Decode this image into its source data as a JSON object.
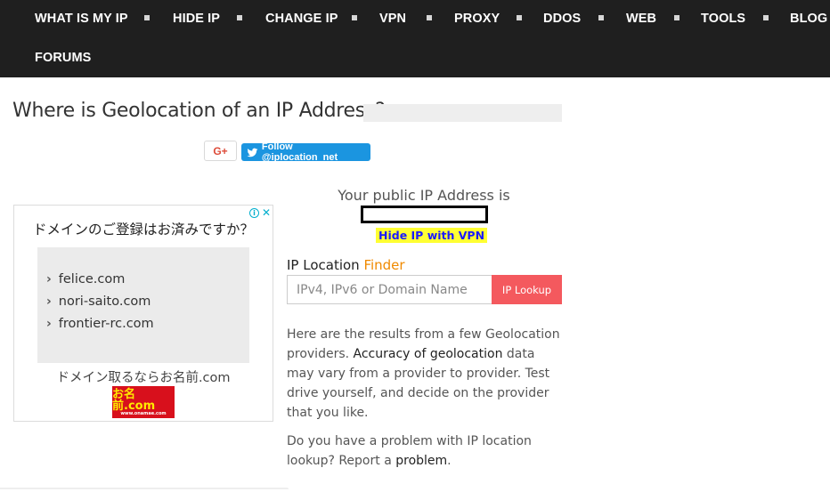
{
  "nav": {
    "row1": [
      "WHAT IS MY IP",
      "HIDE IP",
      "CHANGE IP",
      "VPN",
      "PROXY",
      "DDOS",
      "WEB",
      "TOOLS",
      "BLOG"
    ],
    "row2": [
      "FORUMS"
    ]
  },
  "title": "Where is Geolocation of an IP Address?",
  "social": {
    "gplus_label": "G+",
    "twitter_label": "Follow @iplocation_net"
  },
  "ad": {
    "headline": "ドメインのご登録はお済みですか？",
    "domains": [
      "felice.com",
      "nori-saito.com",
      "frontier-rc.com"
    ],
    "caption": "ドメイン取るならお名前.com",
    "logo_text": "お名前.com",
    "logo_subtext": "www.onamae.com"
  },
  "public_ip": {
    "label": "Your public IP Address is",
    "vpn_link": "Hide IP with VPN"
  },
  "finder": {
    "title_main": "IP Location ",
    "title_accent": "Finder",
    "input_placeholder": "IPv4, IPv6 or Domain Name",
    "button_label": "IP Lookup"
  },
  "intro": {
    "p1_part1": "Here are the results from a few Geolocation providers. ",
    "p1_link": "Accuracy of geolocation",
    "p1_part2": " data may vary from a provider to provider. Test drive yourself, and decide on the provider that you like.",
    "p2_part1": "Do you have a problem with IP location lookup? Report a ",
    "p2_link": "problem",
    "p2_part2": "."
  },
  "colors": {
    "nav_bg": "#1f1f1f",
    "accent_orange": "#f08a00",
    "lookup_button": "#f4595e",
    "twitter_blue": "#1b95e0",
    "highlight_yellow": "#ffff33"
  }
}
